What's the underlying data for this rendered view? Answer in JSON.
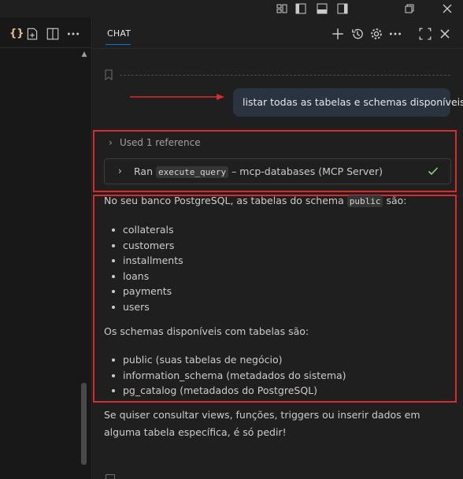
{
  "chat": {
    "tab_label": "CHAT"
  },
  "user_message": "listar todas as tabelas e schemas disponíveis",
  "reference": {
    "label": "Used 1 reference"
  },
  "tool_call": {
    "prefix": "Ran",
    "tool_name": "execute_query",
    "suffix": "– mcp-databases (MCP Server)",
    "status": "success"
  },
  "response": {
    "intro_before": "No seu banco PostgreSQL, as tabelas do schema",
    "intro_code": "public",
    "intro_after": "são:",
    "tables": [
      "collaterals",
      "customers",
      "installments",
      "loans",
      "payments",
      "users"
    ],
    "schemas_intro": "Os schemas disponíveis com tabelas são:",
    "schemas": [
      "public (suas tabelas de negócio)",
      "information_schema (metadados do sistema)",
      "pg_catalog (metadados do PostgreSQL)"
    ],
    "closing": "Se quiser consultar views, funções, triggers ou inserir dados em alguma tabela específica, é só pedir!"
  },
  "colors": {
    "accent": "#0078d4",
    "annotation_red": "#d92b2b",
    "success_green": "#89d185",
    "bubble_bg": "#2a3440"
  },
  "icons": {
    "titlebar": [
      "layout-icon",
      "toggle-primary-sidebar-icon",
      "toggle-panel-icon",
      "toggle-secondary-sidebar-icon",
      "restore-window-icon",
      "close-window-icon"
    ],
    "left_toolbar": [
      "braces-icon",
      "new-file-icon",
      "split-editor-icon",
      "more-actions-icon"
    ],
    "chat_header": [
      "new-chat-icon",
      "history-icon",
      "settings-icon",
      "more-actions-icon",
      "maximize-icon",
      "close-icon"
    ]
  }
}
